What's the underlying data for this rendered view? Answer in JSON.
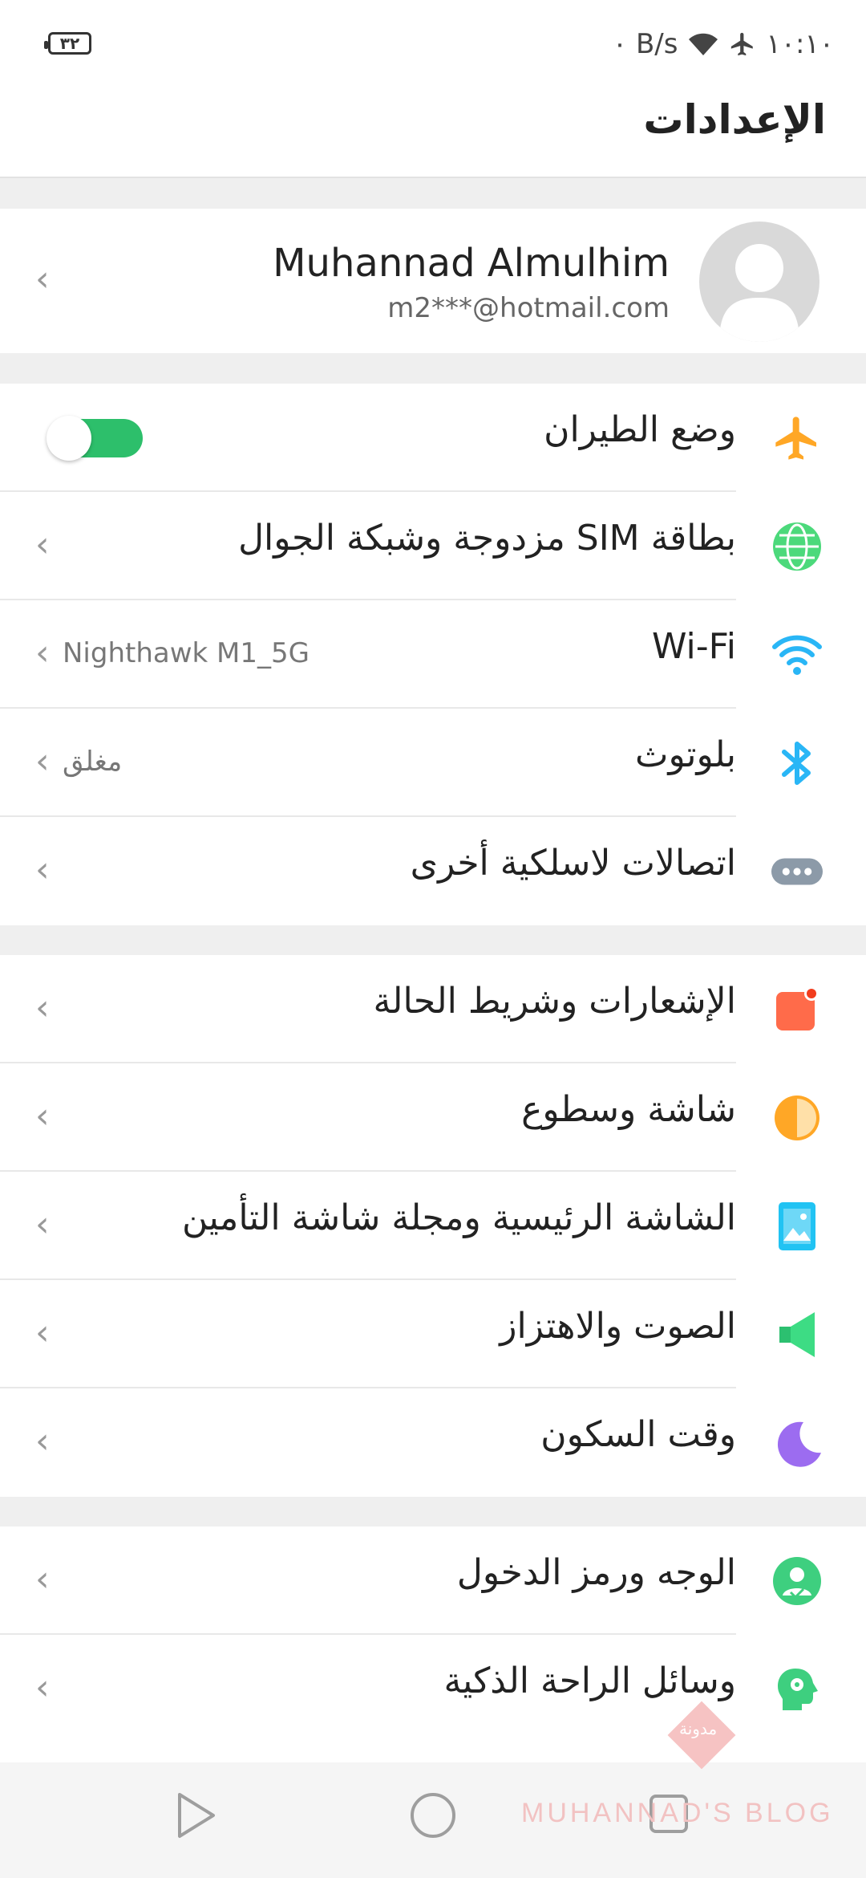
{
  "status": {
    "battery": "٣٢",
    "speed": "٠ B/s",
    "time": "١٠:١٠"
  },
  "header": {
    "title": "الإعدادات"
  },
  "profile": {
    "name": "Muhannad Almulhim",
    "email": "m2***@hotmail.com"
  },
  "group1": [
    {
      "label": "وضع الطيران",
      "icon": "airplane-icon",
      "toggle": true
    },
    {
      "label": "بطاقة SIM مزدوجة وشبكة الجوال",
      "icon": "globe-icon"
    },
    {
      "label": "Wi-Fi",
      "icon": "wifi-icon",
      "value": "Nighthawk M1_5G"
    },
    {
      "label": "بلوتوث",
      "icon": "bluetooth-icon",
      "value": "مغلق"
    },
    {
      "label": "اتصالات لاسلكية أخرى",
      "icon": "more-connections-icon"
    }
  ],
  "group2": [
    {
      "label": "الإشعارات وشريط الحالة",
      "icon": "notification-icon"
    },
    {
      "label": "شاشة وسطوع",
      "icon": "brightness-icon"
    },
    {
      "label": "الشاشة الرئيسية ومجلة شاشة التأمين",
      "icon": "wallpaper-icon"
    },
    {
      "label": "الصوت والاهتزاز",
      "icon": "sound-icon"
    },
    {
      "label": "وقت السكون",
      "icon": "moon-icon"
    }
  ],
  "group3": [
    {
      "label": "الوجه ورمز الدخول",
      "icon": "face-passcode-icon"
    },
    {
      "label": "وسائل الراحة الذكية",
      "icon": "smart-assist-icon"
    }
  ],
  "watermark": {
    "text": "MUHANNAD'S BLOG",
    "badge": "مدونة"
  },
  "colors": {
    "toggle_on": "#2dbf6b",
    "airplane": "#ffa726",
    "wifi": "#29b6f6",
    "globe": "#4cd97b"
  }
}
